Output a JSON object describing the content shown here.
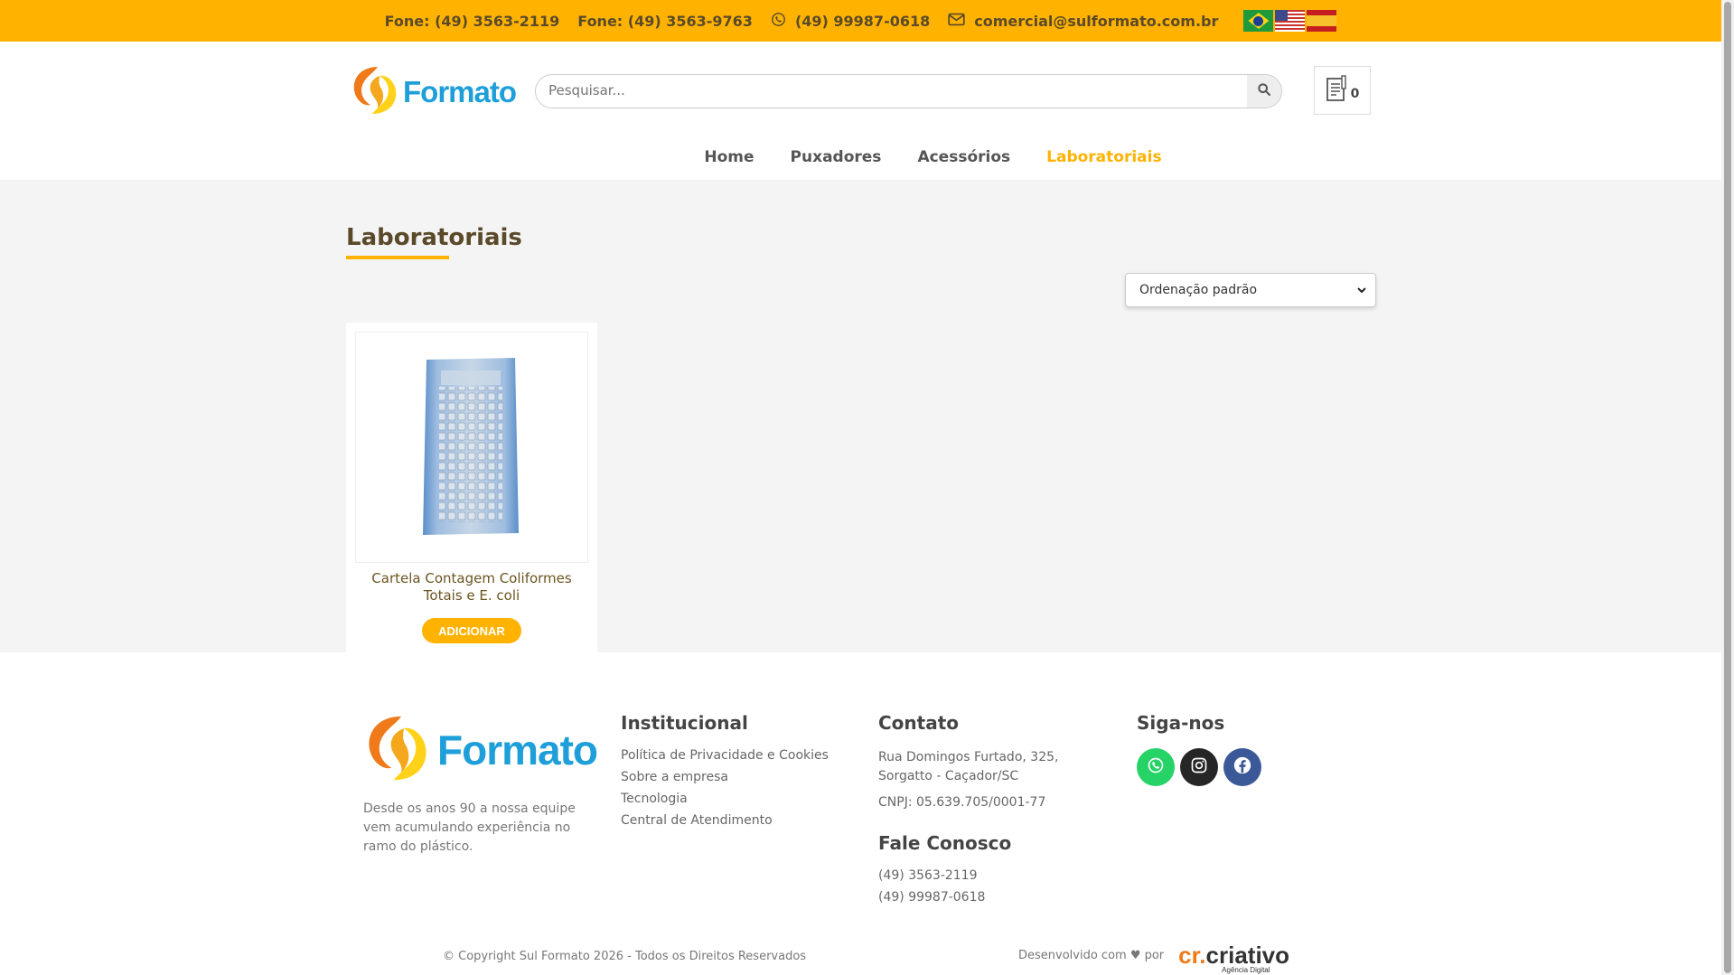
{
  "topbar": {
    "phone1": "Fone: (49) 3563-2119",
    "phone2": "Fone: (49) 3563-9763",
    "whatsapp": "(49) 99987-0618",
    "email": "comercial@sulformato.com.br",
    "flags": [
      "brazil-flag",
      "usa-flag",
      "spain-flag"
    ]
  },
  "header": {
    "logo_text": "Formato",
    "search_placeholder": "Pesquisar...",
    "cart_count": "0"
  },
  "nav": {
    "items": [
      "Home",
      "Puxadores",
      "Acessórios",
      "Laboratoriais"
    ],
    "active": "Laboratoriais"
  },
  "main": {
    "title": "Laboratoriais",
    "sort_selected": "Ordenação padrão",
    "products": [
      {
        "name": "Cartela Contagem Coliformes Totais e E. coli",
        "button": "ADICIONAR"
      }
    ]
  },
  "footer": {
    "logo_text": "Formato",
    "about": "Desde os anos 90 a nossa equipe vem acumulando experiência no ramo do plástico.",
    "institucional": {
      "title": "Institucional",
      "links": [
        "Política de Privacidade e Cookies",
        "Sobre a empresa",
        "Tecnologia",
        "Central de Atendimento"
      ]
    },
    "contato": {
      "title": "Contato",
      "address_line1": "Rua Domingos Furtado, 325,",
      "address_line2": "Sorgatto - Caçador/SC",
      "cnpj": "CNPJ: 05.639.705/0001-77"
    },
    "fale": {
      "title": "Fale Conosco",
      "phone": "(49) 3563-2119",
      "whatsapp": "(49) 99987-0618"
    },
    "siga": {
      "title": "Siga-nos"
    },
    "copyright": "© Copyright Sul Formato 2026 - Todos os Direitos Reservados",
    "credit": "Desenvolvido com ♥ por",
    "credit_brand_a": "cr.",
    "credit_brand_b": "criativo",
    "credit_brand_sub": "Agência Digital"
  },
  "colors": {
    "accent": "#ffb300",
    "brand_blue": "#1e9fd9",
    "brand_orange": "#f07a1a",
    "whatsapp": "#25d366",
    "instagram": "#262626",
    "facebook": "#3b5998"
  }
}
